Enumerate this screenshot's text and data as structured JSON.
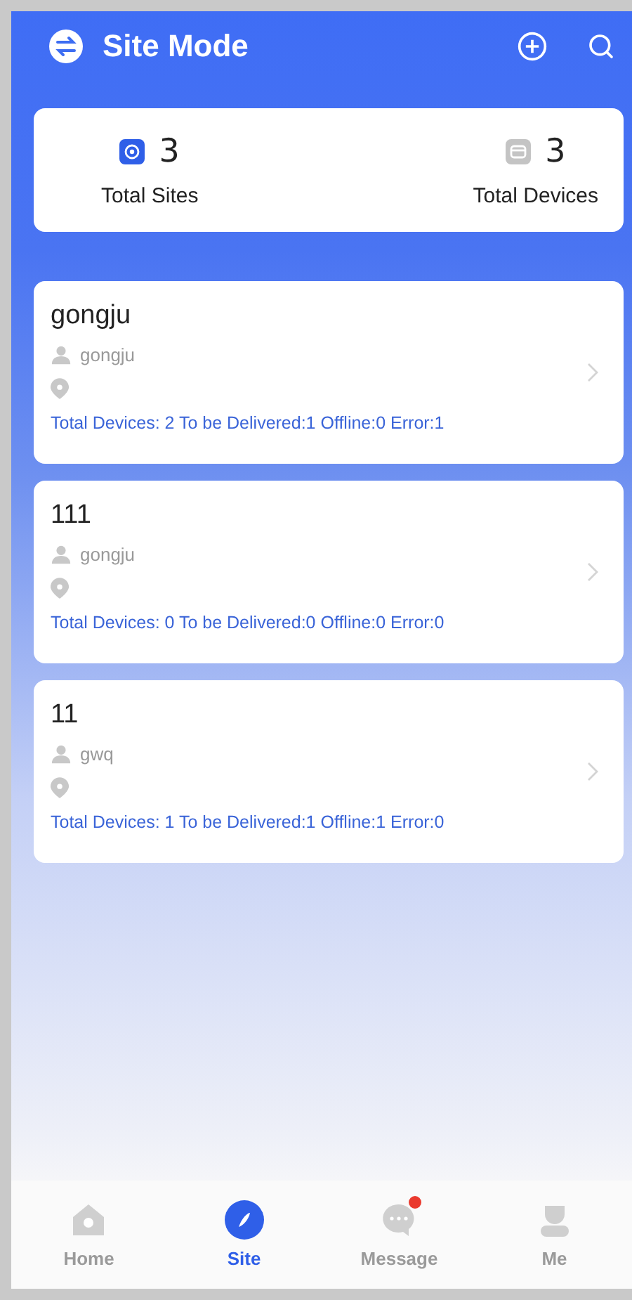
{
  "header": {
    "title": "Site Mode"
  },
  "summary": [
    {
      "kind": "sites",
      "count": "3",
      "label": "Total Sites"
    },
    {
      "kind": "devices",
      "count": "3",
      "label": "Total Devices"
    }
  ],
  "sites": [
    {
      "name": "gongju",
      "owner": "gongju",
      "stats": "Total Devices: 2 To be Delivered:1 Offline:0 Error:1"
    },
    {
      "name": "111",
      "owner": "gongju",
      "stats": "Total Devices: 0 To be Delivered:0 Offline:0 Error:0"
    },
    {
      "name": "11",
      "owner": "gwq",
      "stats": "Total Devices: 1 To be Delivered:1 Offline:1 Error:0"
    }
  ],
  "nav": [
    {
      "kind": "home",
      "label": "Home",
      "selected": false,
      "badge": false
    },
    {
      "kind": "site",
      "label": "Site",
      "selected": true,
      "badge": false
    },
    {
      "kind": "message",
      "label": "Message",
      "selected": false,
      "badge": true
    },
    {
      "kind": "me",
      "label": "Me",
      "selected": false,
      "badge": false
    }
  ]
}
